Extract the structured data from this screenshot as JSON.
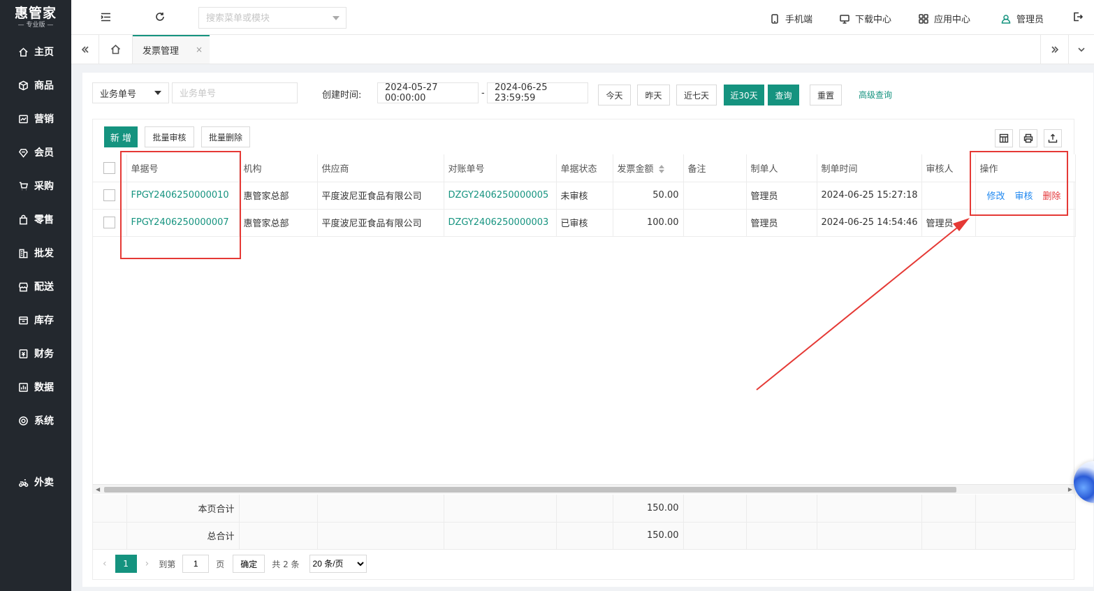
{
  "brand": {
    "name": "惠管家",
    "edition": "专业版"
  },
  "sidebar": {
    "items": [
      {
        "label": "主页",
        "icon": "home-icon"
      },
      {
        "label": "商品",
        "icon": "box-icon"
      },
      {
        "label": "营销",
        "icon": "chart-icon"
      },
      {
        "label": "会员",
        "icon": "member-icon"
      },
      {
        "label": "采购",
        "icon": "cart-icon"
      },
      {
        "label": "零售",
        "icon": "bag-icon"
      },
      {
        "label": "批发",
        "icon": "building-icon"
      },
      {
        "label": "配送",
        "icon": "store-icon"
      },
      {
        "label": "库存",
        "icon": "inventory-icon"
      },
      {
        "label": "财务",
        "icon": "finance-icon"
      },
      {
        "label": "数据",
        "icon": "data-icon"
      },
      {
        "label": "系统",
        "icon": "settings-icon"
      }
    ],
    "extra": {
      "label": "外卖",
      "icon": "delivery-icon"
    }
  },
  "header": {
    "search_placeholder": "搜索菜单或模块",
    "mobile": "手机端",
    "download": "下载中心",
    "apps": "应用中心",
    "user": "管理员"
  },
  "tabs": {
    "active": "发票管理",
    "close": "×"
  },
  "filter": {
    "field_select": "业务单号",
    "field_placeholder": "业务单号",
    "created_label": "创建时间:",
    "start": "2024-05-27 00:00:00",
    "sep": "-",
    "end": "2024-06-25 23:59:59",
    "today": "今天",
    "yesterday": "昨天",
    "last7": "近七天",
    "last30": "近30天",
    "query": "查询",
    "reset": "重置",
    "advanced": "高级查询"
  },
  "toolbar": {
    "add": "新 增",
    "batch_audit": "批量审核",
    "batch_delete": "批量删除"
  },
  "table": {
    "columns": [
      "单据号",
      "机构",
      "供应商",
      "对账单号",
      "单据状态",
      "发票金额",
      "备注",
      "制单人",
      "制单时间",
      "审核人",
      "操作"
    ],
    "rows": [
      {
        "no": "FPGY2406250000010",
        "org": "惠管家总部",
        "supplier": "平度波尼亚食品有限公司",
        "recon": "DZGY2406250000005",
        "status": "未审核",
        "amount": "50.00",
        "remark": "",
        "maker": "管理员",
        "time": "2024-06-25 15:27:18",
        "auditor": "",
        "ops": [
          "修改",
          "审核",
          "删除"
        ]
      },
      {
        "no": "FPGY2406250000007",
        "org": "惠管家总部",
        "supplier": "平度波尼亚食品有限公司",
        "recon": "DZGY2406250000003",
        "status": "已审核",
        "amount": "100.00",
        "remark": "",
        "maker": "管理员",
        "time": "2024-06-25 14:54:46",
        "auditor": "管理员",
        "ops": []
      }
    ],
    "totals": [
      {
        "label": "本页合计",
        "amount": "150.00"
      },
      {
        "label": "总合计",
        "amount": "150.00"
      }
    ]
  },
  "pager": {
    "current": "1",
    "goto": "到第",
    "page_value": "1",
    "page_unit": "页",
    "confirm": "确定",
    "total": "共 2 条",
    "size": "20 条/页"
  }
}
